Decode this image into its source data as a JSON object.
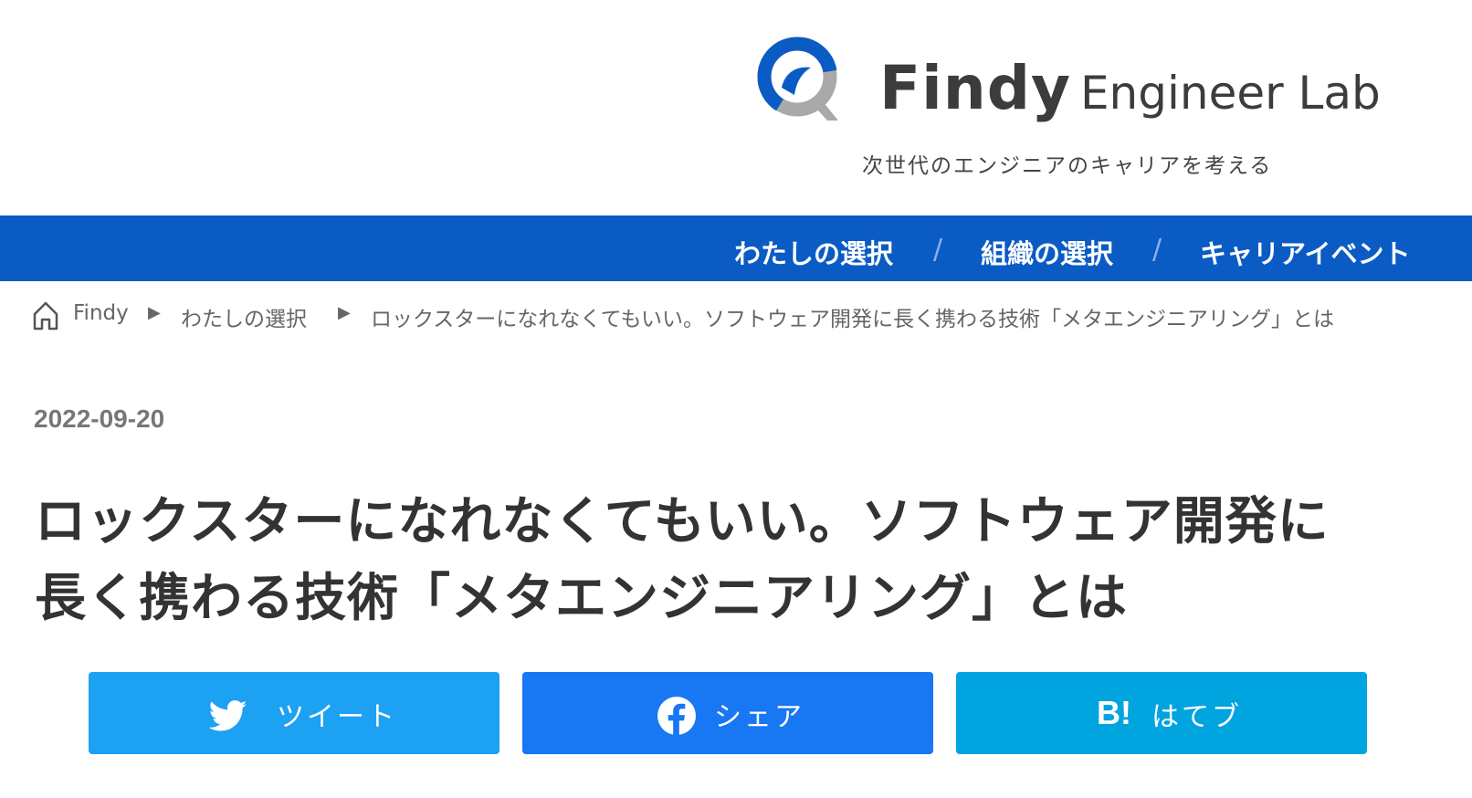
{
  "header": {
    "logo": {
      "name": "Findy",
      "suffix": "Engineer Lab"
    },
    "tagline": "次世代のエンジニアのキャリアを考える"
  },
  "nav": {
    "items": [
      {
        "label": "わたしの選択"
      },
      {
        "label": "組織の選択"
      },
      {
        "label": "キャリアイベント"
      }
    ],
    "separator": "/"
  },
  "breadcrumb": {
    "items": [
      {
        "label": "Findy"
      },
      {
        "label": "わたしの選択"
      },
      {
        "label": "ロックスターになれなくてもいい。ソフトウェア開発に長く携わる技術「メタエンジニアリング」とは"
      }
    ],
    "separator": "▶"
  },
  "article": {
    "date": "2022-09-20",
    "title_line1": "ロックスターになれなくてもいい。ソフトウェア開発に",
    "title_line2": "長く携わる技術「メタエンジニアリング」とは"
  },
  "share": {
    "tweet": {
      "label": "ツイート",
      "icon": "twitter-bird-icon",
      "color": "#1da1f2"
    },
    "facebook": {
      "label": "シェア",
      "icon": "facebook-icon",
      "color": "#1877f2"
    },
    "hatena": {
      "label": "はてブ",
      "icon_text": "B!",
      "icon": "hatena-bookmark-icon",
      "color": "#00a4de"
    }
  },
  "colors": {
    "nav_background": "#0b5bc4",
    "logo_blue": "#0b5bc4",
    "logo_gray": "#a9a9a9"
  }
}
